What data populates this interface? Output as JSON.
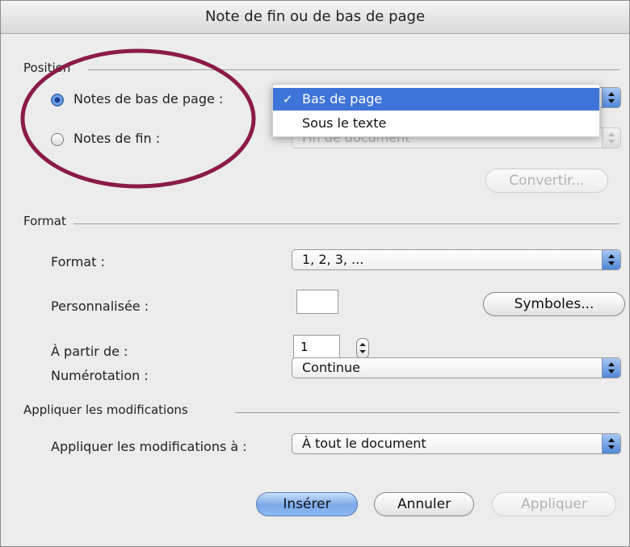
{
  "dialog": {
    "title": "Note de fin ou de bas de page"
  },
  "position": {
    "section_label": "Position",
    "footnotes_label": "Notes de bas de page :",
    "endnotes_label": "Notes de fin :",
    "footnotes_selected": true,
    "footnotes_menu": {
      "items": [
        "Bas de page",
        "Sous le texte"
      ],
      "selected": "Bas de page",
      "checkmark": "✓"
    },
    "endnotes_popup_value": "Fin de document",
    "convert_button": "Convertir..."
  },
  "format": {
    "section_label": "Format",
    "format_label": "Format :",
    "format_value": "1, 2, 3, ...",
    "custom_label": "Personnalisée :",
    "custom_value": "",
    "symbols_button": "Symboles...",
    "start_at_label": "À partir de :",
    "start_at_value": "1",
    "numbering_label": "Numérotation :",
    "numbering_value": "Continue"
  },
  "apply": {
    "section_label": "Appliquer les modifications",
    "apply_to_label": "Appliquer les modifications à :",
    "apply_to_value": "À tout le document"
  },
  "buttons": {
    "insert": "Insérer",
    "cancel": "Annuler",
    "apply": "Appliquer"
  },
  "colors": {
    "highlight": "#3e74d8",
    "annotation_ellipse": "#8b1a4a",
    "primary_button": "#7aa9ea"
  }
}
